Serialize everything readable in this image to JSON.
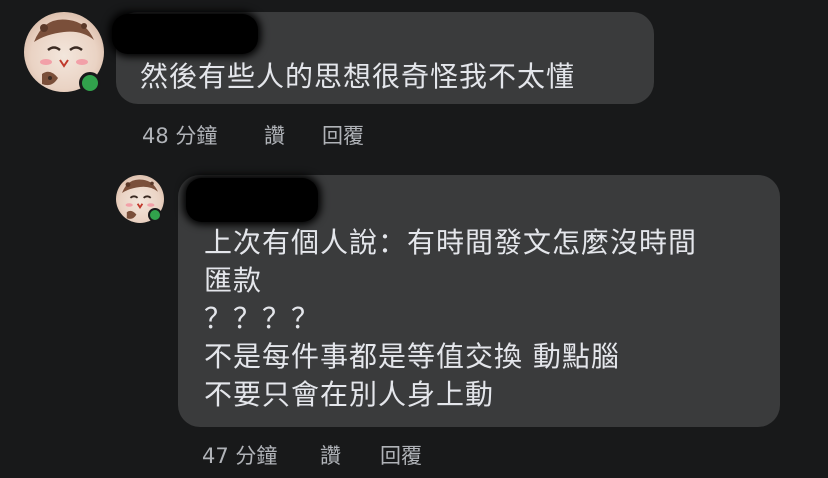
{
  "comments": [
    {
      "text_lines": [
        "然後有些人的思想很奇怪我不太懂"
      ],
      "time": "48 分鐘",
      "like_label": "讚",
      "reply_label": "回覆"
    },
    {
      "text_lines": [
        "上次有個人說：有時間發文怎麼沒時間",
        "匯款",
        "？？？？",
        "不是每件事都是等值交換 動點腦",
        "不要只會在別人身上動"
      ],
      "time": "47 分鐘",
      "like_label": "讚",
      "reply_label": "回覆"
    }
  ],
  "colors": {
    "background": "#18191a",
    "bubble": "#3a3b3c",
    "text": "#e4e6eb",
    "secondary_text": "#b0b3b8",
    "online": "#31a24c"
  },
  "icons": [
    "avatar-illustration",
    "online-status-dot"
  ]
}
